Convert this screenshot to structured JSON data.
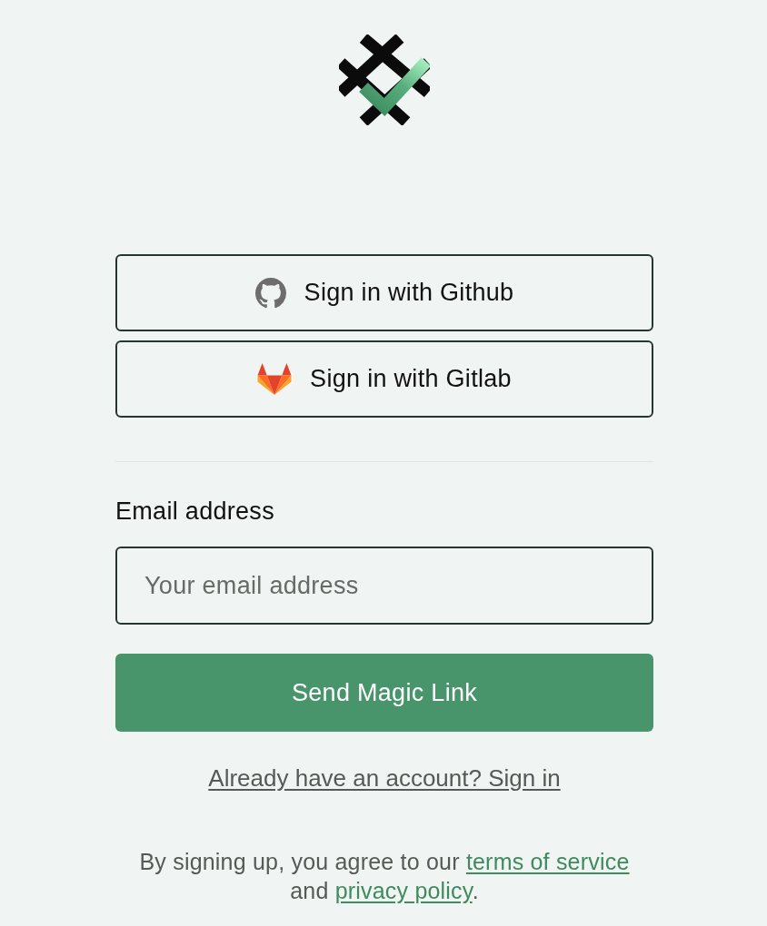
{
  "oauth_buttons": [
    {
      "kind": "github",
      "label": "Sign in with Github"
    },
    {
      "kind": "gitlab",
      "label": "Sign in with Gitlab"
    }
  ],
  "email_form": {
    "label": "Email address",
    "placeholder": "Your email address",
    "submit": "Send Magic Link"
  },
  "sign_in_link": "Already have an account? Sign in",
  "legal": {
    "text_before": "By signing up, you agree to our",
    "terms_link": "terms of service",
    "text_middle": "and",
    "privacy_link": "privacy policy",
    "text_after": "."
  }
}
